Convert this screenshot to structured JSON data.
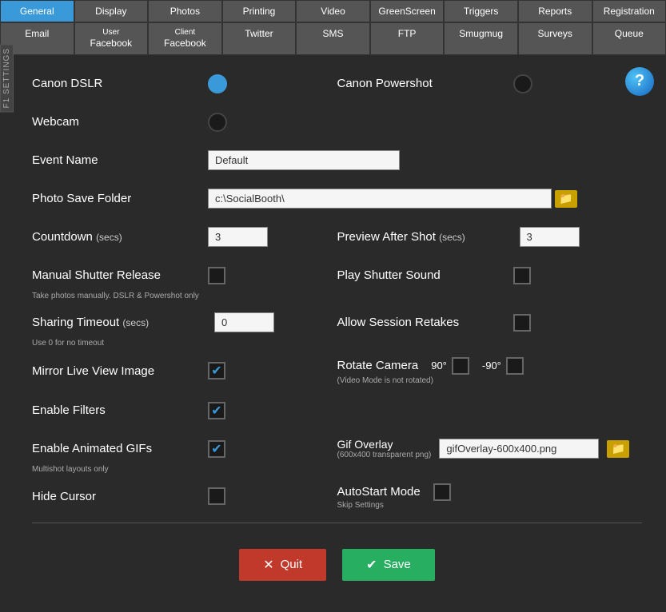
{
  "tabs_row1": [
    {
      "label": "General",
      "active": true
    },
    {
      "label": "Display",
      "active": false
    },
    {
      "label": "Photos",
      "active": false
    },
    {
      "label": "Printing",
      "active": false
    },
    {
      "label": "Video",
      "active": false
    },
    {
      "label": "GreenScreen",
      "active": false
    },
    {
      "label": "Triggers",
      "active": false
    },
    {
      "label": "Reports",
      "active": false
    },
    {
      "label": "Registration",
      "active": false
    }
  ],
  "tabs_row2": [
    {
      "label": "Email",
      "active": false,
      "sub": ""
    },
    {
      "label": "Facebook",
      "active": false,
      "sub": "User"
    },
    {
      "label": "Facebook",
      "active": false,
      "sub": "Client"
    },
    {
      "label": "Twitter",
      "active": false,
      "sub": ""
    },
    {
      "label": "SMS",
      "active": false,
      "sub": ""
    },
    {
      "label": "FTP",
      "active": false,
      "sub": ""
    },
    {
      "label": "Smugmug",
      "active": false,
      "sub": ""
    },
    {
      "label": "Surveys",
      "active": false,
      "sub": ""
    },
    {
      "label": "Queue",
      "active": false,
      "sub": ""
    }
  ],
  "settings_badge": "F1 SETTINGS",
  "help_icon": "?",
  "canon_dslr": {
    "label": "Canon DSLR",
    "selected": true
  },
  "canon_powershot": {
    "label": "Canon Powershot",
    "selected": false
  },
  "webcam": {
    "label": "Webcam",
    "selected": false
  },
  "event_name": {
    "label": "Event Name",
    "value": "Default"
  },
  "photo_save_folder": {
    "label": "Photo Save Folder",
    "value": "c:\\SocialBooth\\"
  },
  "countdown": {
    "label": "Countdown",
    "secs": "(secs)",
    "value": "3"
  },
  "preview_after_shot": {
    "label": "Preview After Shot",
    "secs": "(secs)",
    "value": "3"
  },
  "manual_shutter": {
    "label": "Manual Shutter Release",
    "sub": "Take photos manually.  DSLR & Powershot only",
    "checked": false
  },
  "play_shutter_sound": {
    "label": "Play Shutter Sound",
    "checked": false
  },
  "sharing_timeout": {
    "label": "Sharing Timeout",
    "secs": "(secs)",
    "sub": "Use 0 for no timeout",
    "value": "0"
  },
  "allow_session_retakes": {
    "label": "Allow Session Retakes",
    "checked": false
  },
  "mirror_live_view": {
    "label": "Mirror Live View Image",
    "checked": true
  },
  "rotate_camera": {
    "label": "Rotate Camera",
    "sub": "(Video Mode is not rotated)",
    "option_90": "90°",
    "option_neg90": "-90°"
  },
  "enable_filters": {
    "label": "Enable Filters",
    "checked": true
  },
  "enable_animated_gifs": {
    "label": "Enable Animated GIFs",
    "sub": "Multishot layouts only",
    "checked": true
  },
  "gif_overlay": {
    "label": "Gif Overlay",
    "sub": "(600x400 transparent png)",
    "value": "gifOverlay-600x400.png"
  },
  "hide_cursor": {
    "label": "Hide Cursor",
    "checked": false
  },
  "autostart_mode": {
    "label": "AutoStart Mode",
    "sub": "Skip Settings",
    "checked": false
  },
  "quit_button": "Quit",
  "save_button": "Save"
}
